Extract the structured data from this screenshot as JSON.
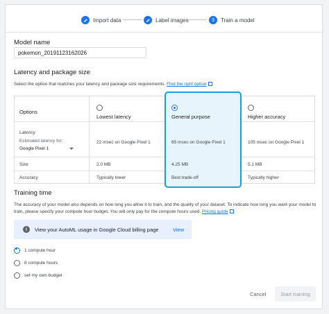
{
  "stepper": {
    "steps": [
      {
        "label": "Import data",
        "state": "done"
      },
      {
        "label": "Label images",
        "state": "done"
      },
      {
        "label": "Train a model",
        "number": "3",
        "state": "active"
      }
    ]
  },
  "model_name": {
    "heading": "Model name",
    "value": "pokemon_20191123162026"
  },
  "latency": {
    "heading": "Latency and package size",
    "description": "Select the option that matches your latency and package size requirements.",
    "link": "Find the right option"
  },
  "table": {
    "options_header": "Options",
    "columns": [
      {
        "label": "Lowest latency",
        "selected": false,
        "latency": "22 msec on Google Pixel 1",
        "size": "2.0 MB",
        "accuracy": "Typically lower"
      },
      {
        "label": "General purpose",
        "selected": true,
        "latency": "65 msec on Google Pixel 1",
        "size": "4.25 MB",
        "accuracy": "Best trade-off"
      },
      {
        "label": "Higher accuracy",
        "selected": false,
        "latency": "105 msec on Google Pixel 1",
        "size": "5.1 MB",
        "accuracy": "Typically higher"
      }
    ],
    "rows": {
      "latency": "Latency",
      "estimated_for": "Estimated latency for:",
      "device": "Google Pixel 1",
      "size": "Size",
      "accuracy": "Accuracy"
    }
  },
  "training": {
    "heading": "Training time",
    "description": "The accuracy of your model also depends on how long you allow it to train, and the quality of your dataset. To indicate how long you want your model to train, please specify your compute hour budget. You will only pay for the compute hours used.",
    "link": "Pricing guide",
    "banner_text": "View your AutoML usage in Google Cloud billing page",
    "banner_action": "View",
    "options": [
      {
        "label": "1 compute hour",
        "selected": true
      },
      {
        "label": "8 compute hours",
        "selected": false
      },
      {
        "label": "set my own budget",
        "selected": false
      }
    ]
  },
  "actions": {
    "cancel": "Cancel",
    "start": "Start training"
  },
  "colors": {
    "accent": "#1a73e8",
    "highlight_border": "#1a9ed8",
    "highlight_bg": "#e8f4fb"
  }
}
